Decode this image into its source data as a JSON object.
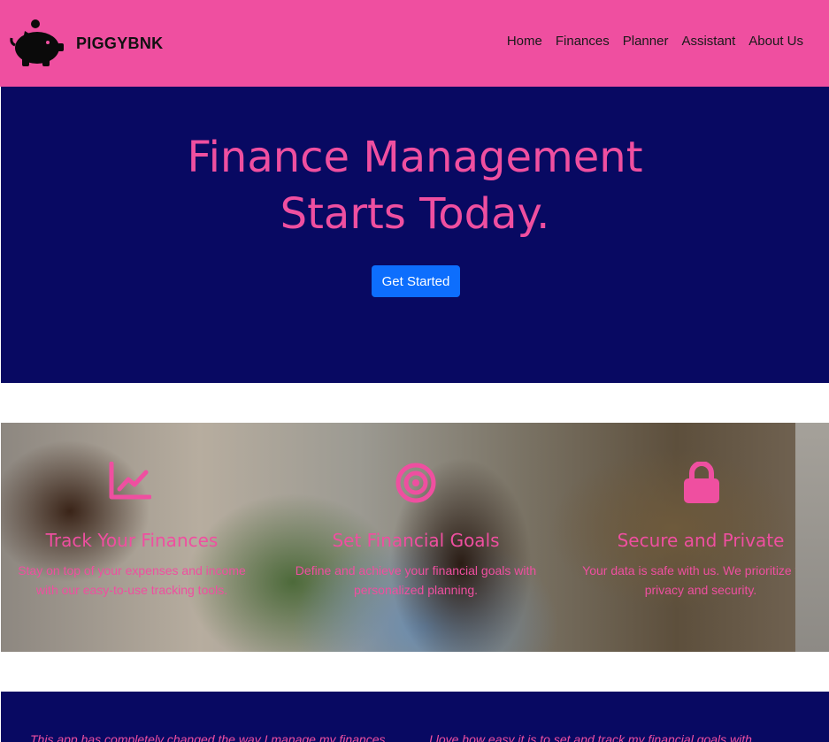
{
  "navbar": {
    "brand_name": "PIGGYBNK",
    "logo_icon": "piggy-bank-icon",
    "background": "#ef4fa0",
    "links": [
      "Home",
      "Finances",
      "Planner",
      "Assistant",
      "About Us"
    ]
  },
  "hero": {
    "title_line1": "Finance Management",
    "title_line2": "Starts Today.",
    "button_label": "Get Started",
    "background": "#080962",
    "accent": "#ef4fa0",
    "button_color": "#0d6efd"
  },
  "features": [
    {
      "icon": "line-chart-icon",
      "title": "Track Your Finances",
      "text_line1": "Stay on top of your expenses and income",
      "text_line2": "with our easy-to-use tracking tools."
    },
    {
      "icon": "target-icon",
      "title": "Set Financial Goals",
      "text_line1": "Define and achieve your financial goals with",
      "text_line2": "personalized planning."
    },
    {
      "icon": "lock-icon",
      "title": "Secure and Private",
      "text_line1": "Your data is safe with us. We prioritize your",
      "text_line2": "privacy and security."
    }
  ],
  "testimonials": [
    "This app has completely changed the way I manage my finances.",
    "I love how easy it is to set and track my financial goals with"
  ]
}
